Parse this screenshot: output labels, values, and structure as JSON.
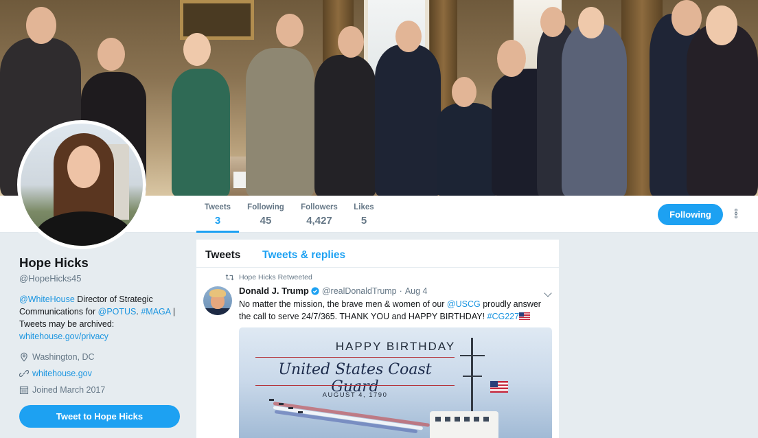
{
  "profile": {
    "name": "Hope Hicks",
    "handle": "@HopeHicks45",
    "bio": {
      "mention_whitehouse": "@WhiteHouse",
      "text1": " Director of Strategic Communications for ",
      "mention_potus": "@POTUS",
      "text2": ". ",
      "hashtag": "#MAGA",
      "text3": " | Tweets may be archived: ",
      "link": "whitehouse.gov/privacy"
    },
    "location": "Washington, DC",
    "website": "whitehouse.gov",
    "joined": "Joined March 2017",
    "tweet_to_label": "Tweet to Hope Hicks"
  },
  "stats": [
    {
      "label": "Tweets",
      "value": "3"
    },
    {
      "label": "Following",
      "value": "45"
    },
    {
      "label": "Followers",
      "value": "4,427"
    },
    {
      "label": "Likes",
      "value": "5"
    }
  ],
  "follow_button": "Following",
  "timeline": {
    "tabs": [
      "Tweets",
      "Tweets & replies"
    ],
    "tweet": {
      "retweet_context": "Hope Hicks Retweeted",
      "author": "Donald J. Trump",
      "handle": "@realDonaldTrump",
      "separator": "·",
      "date": "Aug 4",
      "text_part1": "No matter the mission, the brave men & women of our ",
      "mention": "@USCG",
      "text_part2": " proudly answer the call to serve 24/7/365. THANK YOU and HAPPY BIRTHDAY! ",
      "hashtag": "#CG227",
      "media": {
        "line1": "HAPPY BIRTHDAY",
        "line2": "United States Coast Guard",
        "line3": "AUGUST 4, 1790"
      }
    }
  },
  "colors": {
    "accent": "#1da1f2",
    "link": "#1b95e0",
    "background": "#e6ecf0"
  }
}
